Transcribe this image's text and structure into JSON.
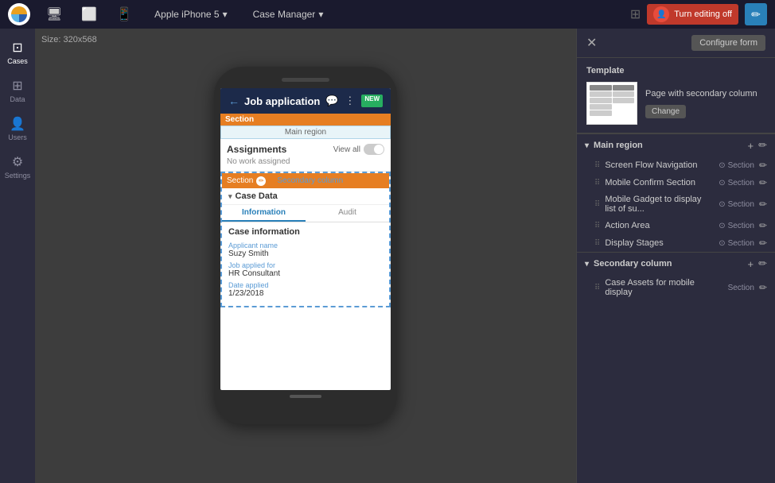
{
  "topbar": {
    "app_name": "Apple iPhone 5",
    "app_name_chevron": "▾",
    "manager_label": "Case Manager",
    "manager_chevron": "▾",
    "editing_label": "Turn editing off",
    "size_label": "Size: 320x568"
  },
  "nav": {
    "items": [
      {
        "id": "cases",
        "label": "Cases",
        "icon": "⊡",
        "active": true
      },
      {
        "id": "data",
        "label": "Data",
        "icon": "⊞"
      },
      {
        "id": "users",
        "label": "Users",
        "icon": "👤"
      },
      {
        "id": "settings",
        "label": "Settings",
        "icon": "⚙"
      }
    ]
  },
  "phone": {
    "header": {
      "title": "Job application",
      "badge": "NEW"
    },
    "section_label": "Section",
    "main_region_label": "Main region",
    "assignments": {
      "title": "Assignments",
      "view_all": "View all",
      "no_work": "No work assigned"
    },
    "secondary_col": "Secondary column",
    "case_data": "Case Data",
    "tabs": [
      "Information",
      "Audit"
    ],
    "case_info": {
      "title": "Case information",
      "fields": [
        {
          "label": "Applicant name",
          "value": "Suzy Smith"
        },
        {
          "label": "Job applied for",
          "value": "HR Consultant"
        },
        {
          "label": "Date applied",
          "value": "1/23/2018"
        }
      ]
    }
  },
  "right_panel": {
    "configure_btn": "Configure form",
    "template": {
      "label": "Template",
      "name": "Page with secondary column",
      "change_btn": "Change"
    },
    "main_region": {
      "label": "Main region",
      "components": [
        {
          "label": "Screen Flow Navigation",
          "section": "Section"
        },
        {
          "label": "Mobile Confirm Section",
          "section": "Section"
        },
        {
          "label": "Mobile Gadget to display list of su...",
          "section": "Section"
        },
        {
          "label": "Action Area",
          "section": "Section"
        },
        {
          "label": "Display Stages",
          "section": "Section"
        }
      ]
    },
    "secondary_column": {
      "label": "Secondary column",
      "components": [
        {
          "label": "Case Assets for mobile display",
          "section": "Section"
        }
      ]
    }
  }
}
